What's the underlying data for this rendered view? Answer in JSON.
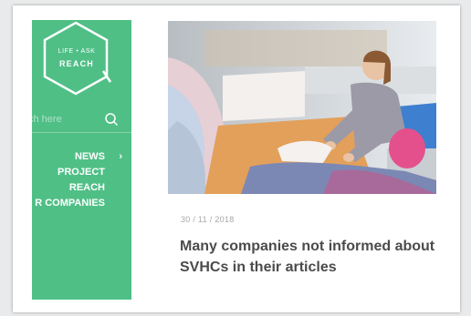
{
  "logo": {
    "top_text": "LIFE • ASK",
    "main_text": "REACH"
  },
  "search": {
    "placeholder": "ch here",
    "icon": "search-icon"
  },
  "nav": {
    "items": [
      {
        "label": "NEWS",
        "has_chevron": true
      },
      {
        "label": "PROJECT"
      },
      {
        "label": "REACH"
      },
      {
        "label": "R COMPANIES"
      }
    ],
    "chevron": "›"
  },
  "article": {
    "image_alt": "Woman sorting garments on a textile workshop table",
    "date": "30 / 11 / 2018",
    "title": "Many companies not informed about SVHCs in their articles"
  },
  "colors": {
    "sidebar": "#4fbf86",
    "headline": "#4b4b4b",
    "date": "#a7a7a7"
  }
}
